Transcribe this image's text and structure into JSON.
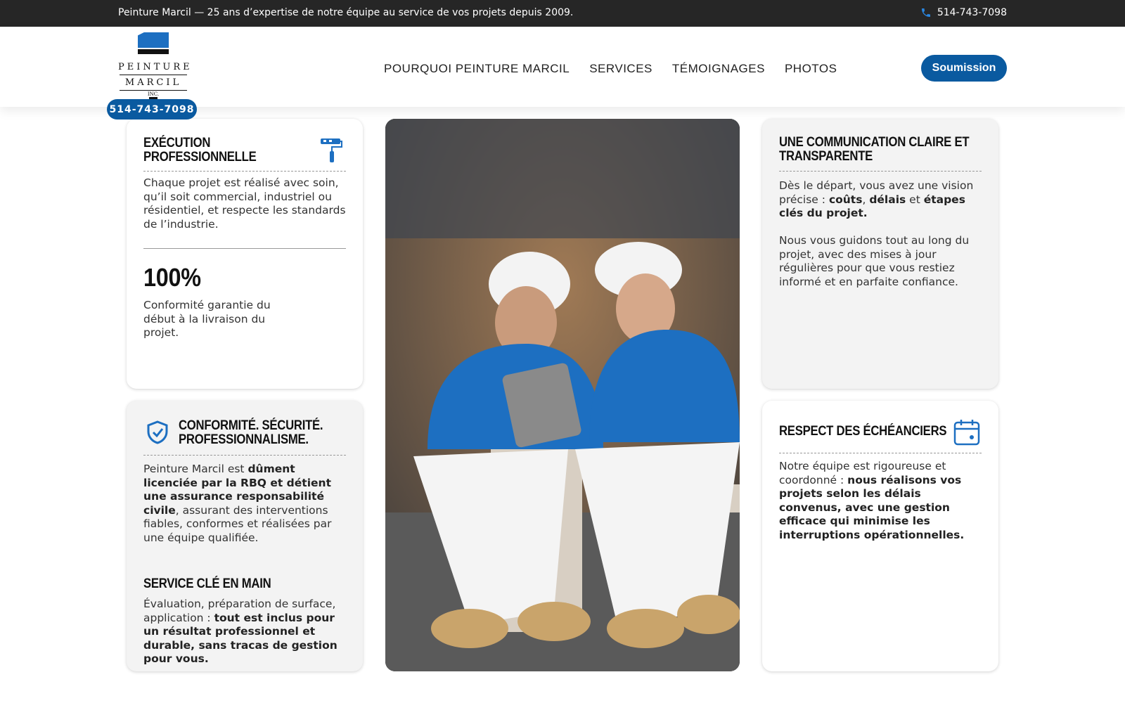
{
  "topbar": {
    "message": "Peinture Marcil — 25 ans d’expertise de notre équipe au service de vos projets depuis 2009.",
    "phone": "514-743-7098"
  },
  "header": {
    "logo": {
      "line1": "PEINTURE",
      "line2": "MARCIL",
      "suffix": "INC."
    },
    "logo_phone": "514-743-7098",
    "nav": [
      "POURQUOI PEINTURE MARCIL",
      "SERVICES",
      "TÉMOIGNAGES",
      "PHOTOS"
    ],
    "cta": "Soumission"
  },
  "cards": {
    "execution": {
      "title_1": "EXÉCUTION",
      "title_2": "PROFESSIONNELLE",
      "text": "Chaque projet est réalisé avec soin, qu’il soit commercial, industriel ou résidentiel, et respecte les standards de l’industrie.",
      "stat": "100%",
      "stat_text": "Conformité garantie du début à la livraison du projet.",
      "icon": "paint-roller-icon"
    },
    "conformite": {
      "title_1": "CONFORMITÉ. SÉCURITÉ.",
      "title_2": "PROFESSIONNALISME.",
      "text_1": "Peinture Marcil est ",
      "text_bold": "dûment licenciée par la RBQ et détient une assurance responsabilité civile",
      "text_2": ", assurant des interventions fiables, conformes et réalisées par une équipe qualifiée.",
      "sub_title": "SERVICE CLÉ EN MAIN",
      "sub_text_1": "Évaluation, préparation de surface, application : ",
      "sub_text_bold": "tout est inclus pour un résultat professionnel et durable, sans tracas de gestion pour vous.",
      "icon": "shield-check-icon"
    },
    "communication": {
      "title_1": "UNE COMMUNICATION CLAIRE ET",
      "title_2": "TRANSPARENTE",
      "p1_a": "Dès le départ, vous avez une vision précise : ",
      "p1_b1": "coûts",
      "p1_sep": ", ",
      "p1_b2": "délais",
      "p1_and": " et ",
      "p1_b3": "étapes clés du projet.",
      "p2": "Nous vous guidons tout au long du projet, avec des mises à jour régulières pour que vous restiez informé et en parfaite confiance."
    },
    "echeanciers": {
      "title": "RESPECT DES ÉCHÉANCIERS",
      "text_1": "Notre équipe est rigoureuse et coordonné : ",
      "text_bold": "nous réalisons vos projets selon les délais convenus, avec une gestion efficace qui minimise les interruptions opérationnelles.",
      "icon": "calendar-icon"
    }
  },
  "photo": {
    "alt": "painters-team-photo"
  },
  "colors": {
    "brand_blue": "#0a5aa0",
    "topbar": "#262626",
    "icon_blue": "#1d6fc1"
  }
}
